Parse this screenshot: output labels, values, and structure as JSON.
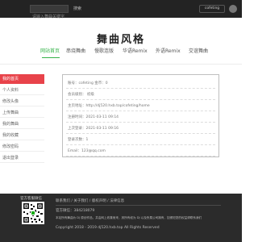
{
  "header": {
    "search_placeholder": "请输入舞曲关键字",
    "search_button": "搜索",
    "user_badge": "cofeting"
  },
  "site": {
    "logo": "舞曲风格"
  },
  "nav": {
    "items": [
      {
        "label": "网站首页",
        "active": true
      },
      {
        "label": "串烧舞曲",
        "active": false
      },
      {
        "label": "慢歌连版",
        "active": false
      },
      {
        "label": "华语Remix",
        "active": false
      },
      {
        "label": "外语Remix",
        "active": false
      },
      {
        "label": "交谊舞曲",
        "active": false
      }
    ]
  },
  "sidebar": {
    "items": [
      {
        "label": "我的首页",
        "active": true
      },
      {
        "label": "个人资料",
        "active": false
      },
      {
        "label": "修改头像",
        "active": false
      },
      {
        "label": "上传舞曲",
        "active": false
      },
      {
        "label": "我的舞曲",
        "active": false
      },
      {
        "label": "我的收藏",
        "active": false
      },
      {
        "label": "修改密码",
        "active": false
      },
      {
        "label": "退出登录",
        "active": false
      }
    ]
  },
  "profile": {
    "rows": [
      "账号：cofeting   金币：0",
      "会员级别：  初级",
      "主页地址：http://dj520.hxb.top/cofeting/home",
      "注册时间：2021-03-11 09:14",
      "上次登录：2021-03-11 09:16",
      "登录次数：1",
      "Email：123@qq.com"
    ]
  },
  "footer": {
    "qr_label": "官方客服微信",
    "lines": [
      "联系我们 / 关于我们 / 版权声明 / 法律信息",
      "官方微信：384218079",
      "本站所有舞曲为 DJ 原创作品，并由网上收集而来，其所有权为 DJ 以及所属公司拥有，如侵犯您的权益请联系我们",
      "Copyright 2018 - 2019 dj520.hxb.top All Rights Reserved"
    ]
  },
  "colors": {
    "accent": "#36b34a",
    "active_side": "#e8434a",
    "topbar": "#232323",
    "footer": "#2b2b2b"
  }
}
